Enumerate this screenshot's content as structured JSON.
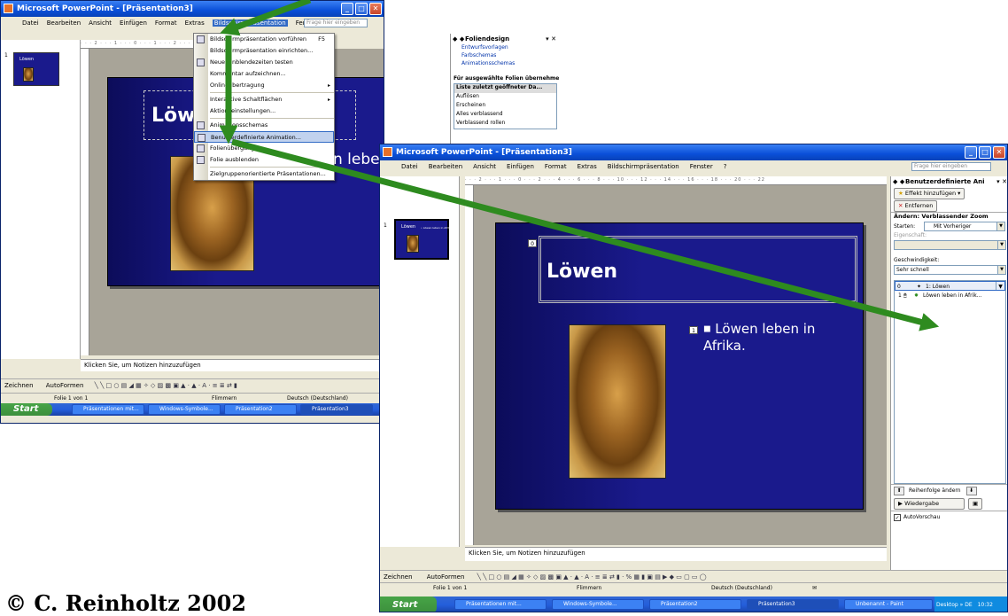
{
  "caption": "© C. Reinholtz 2002",
  "app_title": "Microsoft PowerPoint - [Präsentation3]",
  "menu": [
    "Datei",
    "Bearbeiten",
    "Ansicht",
    "Einfügen",
    "Format",
    "Extras",
    "Bildschirmpräsentation",
    "Fenster",
    "?"
  ],
  "ask_placeholder": "Frage hier eingeben",
  "slide": {
    "title": "Löwen",
    "bullet": "Löwen leben in Afrika.",
    "title_short": "Löwe",
    "bullet_tail": "n leben in",
    "tag_title": "0",
    "tag_bullet": "1"
  },
  "thumb": {
    "number": "1",
    "title": "Löwen",
    "text": "• Löwen leben in Afrika"
  },
  "notes_placeholder": "Klicken Sie, um Notizen hinzuzufügen",
  "draw_bar": {
    "zeichnen": "Zeichnen",
    "autoformen": "AutoFormen"
  },
  "status": {
    "slide": "Folie 1 von 1",
    "design": "Flimmern",
    "lang": "Deutsch (Deutschland)"
  },
  "dropdown": [
    {
      "label": "Bildschirmpräsentation vorführen",
      "shortcut": "F5"
    },
    {
      "label": "Bildschirmpräsentation einrichten..."
    },
    {
      "label": "Neue Einblendezeiten testen"
    },
    {
      "label": "Kommentar aufzeichnen..."
    },
    {
      "label": "Onlineübertragung",
      "submenu": "▸"
    },
    {
      "label": "Interaktive Schaltflächen",
      "submenu": "▸"
    },
    {
      "label": "Aktionseinstellungen..."
    },
    {
      "label": "Animationsschemas"
    },
    {
      "label": "Benutzerdefinierte Animation...",
      "highlighted": true
    },
    {
      "label": "Folienübergang..."
    },
    {
      "label": "Folie ausblenden"
    },
    {
      "label": "Zielgruppenorientierte Präsentationen..."
    }
  ],
  "design_pane": {
    "title": "Foliendesign",
    "links": [
      "Entwurfsvorlagen",
      "Farbschemas",
      "Animationsschemas"
    ],
    "section": "Für ausgewählte Folien übernehme",
    "list_header": "Liste zuletzt geöffneter Da...",
    "list": [
      "Auflösen",
      "Erscheinen",
      "Alles verblassend",
      "Verblassend rollen"
    ]
  },
  "anim_pane": {
    "title": "Benutzerdefinierte Ani",
    "add_effect": "Effekt hinzufügen",
    "remove": "Entfernen",
    "change": "Ändern: Verblassender Zoom",
    "start_label": "Starten:",
    "start_value": "Mit Vorheriger",
    "property_label": "Eigenschaft:",
    "speed_label": "Geschwindigkeit:",
    "speed_value": "Sehr schnell",
    "items": [
      {
        "order": "0",
        "label": "1: Löwen"
      },
      {
        "order": "1",
        "label": "Löwen leben in Afrik..."
      }
    ],
    "reorder": "Reihenfolge ändern",
    "play": "Wiedergabe",
    "autopreview": "AutoVorschau"
  },
  "taskbar_back": [
    "Präsentationen mit...",
    "Windows-Symbole...",
    "Präsentation2",
    "Präsentation3"
  ],
  "taskbar_front": [
    "Präsentationen mit...",
    "Windows-Symbole...",
    "Präsentation2",
    "Präsentation3",
    "Unbenannt - Paint"
  ],
  "start": "Start",
  "tray": {
    "desktop": "Desktop",
    "lang": "DE",
    "clock": "10:32"
  },
  "colors": {
    "arrow": "#2e8b1f",
    "slide_bg": "#1a1a8c",
    "xp_blue": "#0a4fd8"
  }
}
